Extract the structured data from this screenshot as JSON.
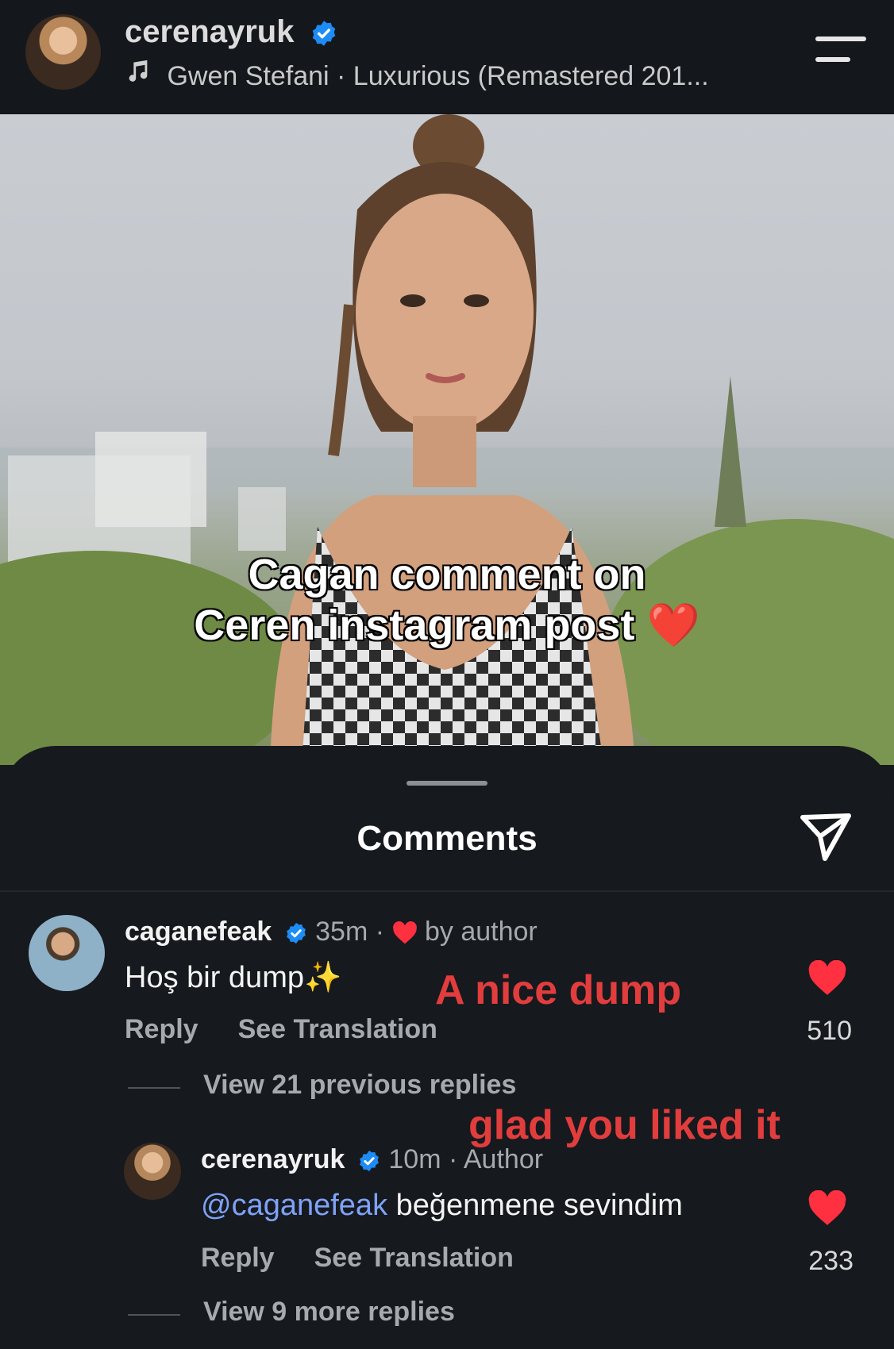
{
  "post_header": {
    "username": "cerenayruk",
    "music": "Gwen Stefani · Luxurious (Remastered 201..."
  },
  "photo": {
    "caption_line1": "Cagan comment on",
    "caption_line2": "Ceren instagram post",
    "caption_emoji": "❤️"
  },
  "comments_sheet": {
    "title": "Comments",
    "comments": [
      {
        "username": "caganefeak",
        "time": "35m",
        "separator": "·",
        "by_author_label": "by author",
        "text": "Hoş bir dump",
        "text_emoji": "✨",
        "reply_label": "Reply",
        "see_translation_label": "See Translation",
        "likes": "510",
        "view_replies": "View 21 previous replies",
        "overlay_translation": "A nice dump"
      },
      {
        "username": "cerenayruk",
        "time": "10m",
        "separator": "·",
        "author_label": "Author",
        "mention": "@caganefeak",
        "text": "beğenmene sevindim",
        "reply_label": "Reply",
        "see_translation_label": "See Translation",
        "likes": "233",
        "view_replies": "View 9 more replies",
        "overlay_translation": "glad you liked it"
      }
    ]
  },
  "colors": {
    "background": "#16191e",
    "verified_blue": "#1d8cf5",
    "like_red": "#ff3040",
    "mention_blue": "#7ea2f7",
    "overlay_red": "#e23d3d"
  },
  "icons": [
    "music-note-icon",
    "verified-badge-icon",
    "menu-icon",
    "share-icon",
    "heart-icon"
  ]
}
